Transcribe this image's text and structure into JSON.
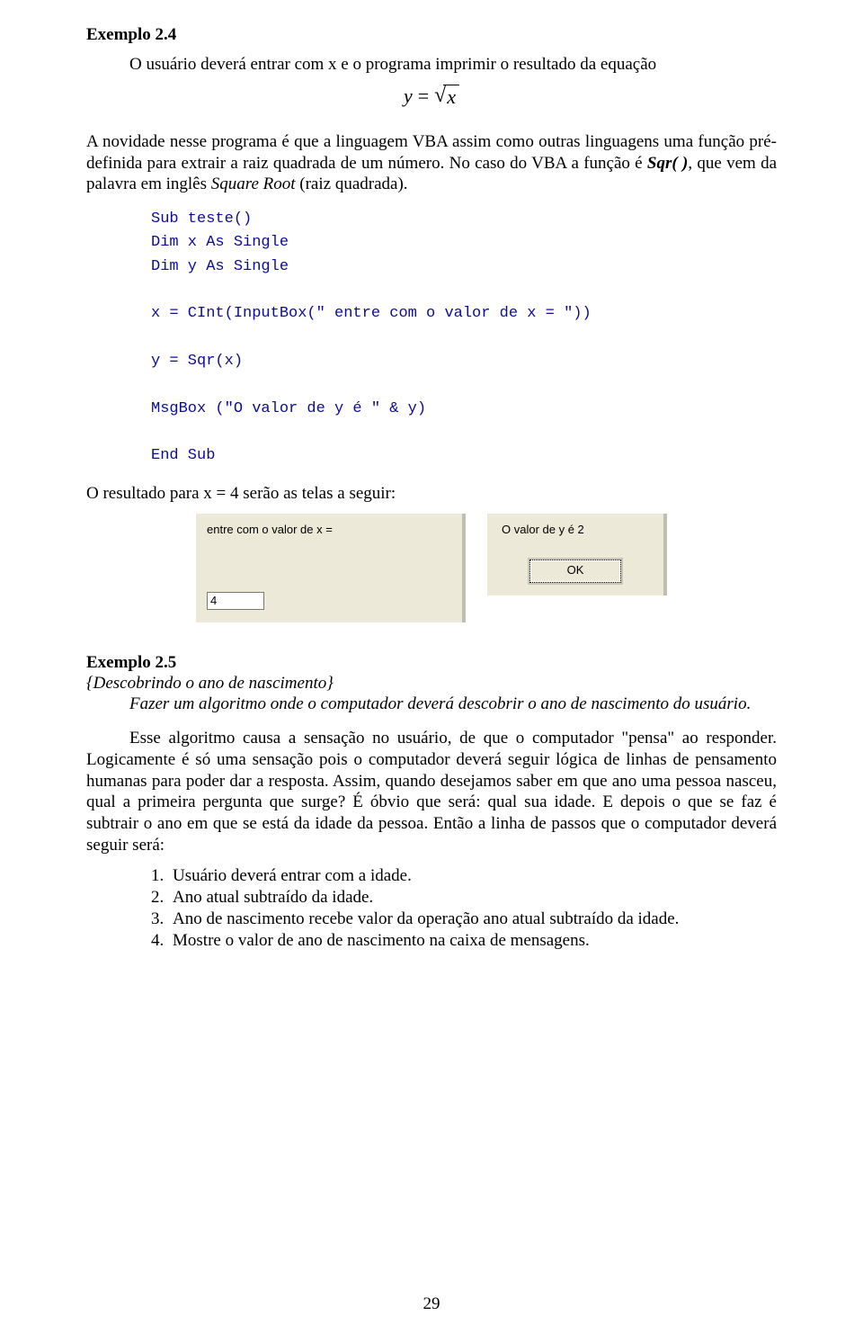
{
  "heading24": "Exemplo 2.4",
  "para24_intro": "O usuário deverá entrar com x e o programa imprimir o resultado da equação",
  "equation": {
    "lhs": "y",
    "eq": "=",
    "under_radical": "x"
  },
  "after_eq": "A novidade nesse programa é que a linguagem VBA assim como outras linguagens uma função pré-definida para extrair a raiz quadrada de um número. No caso do VBA a função é ",
  "after_eq_boldit": "Sqr( )",
  "after_eq_tail": ", que vem da palavra em inglês ",
  "after_eq_it": "Square Root",
  "after_eq_end": " (raiz quadrada).",
  "code": "Sub teste()\nDim x As Single\nDim y As Single\n\nx = CInt(InputBox(\" entre com o valor de x = \"))\n\ny = Sqr(x)\n\nMsgBox (\"O valor de y é \" & y)\n\nEnd Sub",
  "result_line": "O resultado para x = 4 serão as telas a seguir:",
  "inputbox": {
    "prompt": "entre com o valor de x =",
    "value": "4"
  },
  "msgbox": {
    "text": "O valor de y é 2",
    "ok": "OK"
  },
  "heading25": "Exemplo 2.5",
  "subtitle25": "{Descobrindo o ano de nascimento}",
  "task25": "Fazer um algoritmo onde o computador deverá descobrir o ano de nascimento do usuário.",
  "discuss25": "Esse algoritmo causa a sensação no usuário, de que o computador \"pensa\" ao responder. Logicamente é só uma sensação pois o computador deverá seguir lógica de linhas de pensamento humanas para poder dar a resposta. Assim, quando desejamos saber em que ano uma pessoa nasceu, qual a primeira pergunta que surge? É óbvio que será: qual sua idade. E depois o que se faz é subtrair o ano em que se está da idade da pessoa. Então a linha de passos que o computador deverá seguir será:",
  "steps": {
    "n1": "1.",
    "t1": "Usuário deverá entrar com a idade.",
    "n2": "2.",
    "t2": "Ano atual subtraído da idade.",
    "n3": "3.",
    "t3": "Ano de nascimento recebe valor da operação ano atual subtraído da idade.",
    "n4": "4.",
    "t4": "Mostre o valor de ano de nascimento na caixa de mensagens."
  },
  "page_number": "29"
}
